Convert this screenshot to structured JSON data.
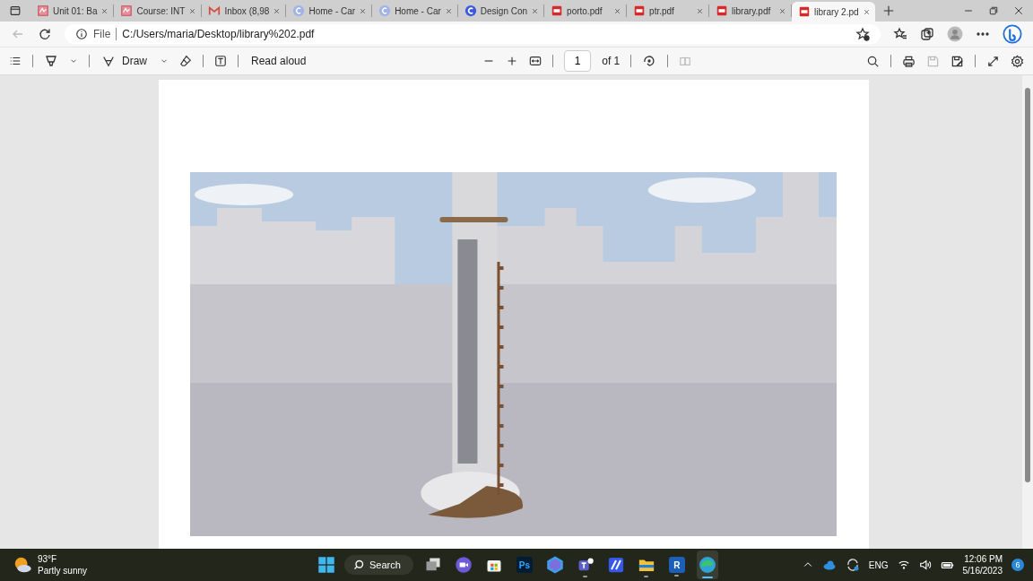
{
  "tabs": [
    {
      "kind": "pdf-pink",
      "label": "Unit 01: Ba",
      "selected": false
    },
    {
      "kind": "pdf-pink",
      "label": "Course: INT",
      "selected": false
    },
    {
      "kind": "mail",
      "label": "Inbox (8,98",
      "selected": false
    },
    {
      "kind": "circle-c",
      "label": "Home - Car",
      "selected": false
    },
    {
      "kind": "circle-c",
      "label": "Home - Car",
      "selected": false
    },
    {
      "kind": "circle-c-bold",
      "label": "Design Con",
      "selected": false
    },
    {
      "kind": "pdf",
      "label": "porto.pdf",
      "selected": false
    },
    {
      "kind": "pdf",
      "label": "ptr.pdf",
      "selected": false
    },
    {
      "kind": "pdf",
      "label": "library.pdf",
      "selected": false
    },
    {
      "kind": "pdf",
      "label": "library 2.pd",
      "selected": true
    }
  ],
  "address_bar": {
    "scheme": "File",
    "url": "C:/Users/maria/Desktop/library%202.pdf"
  },
  "pdf_toolbar": {
    "draw_label": "Draw",
    "read_aloud_label": "Read aloud",
    "page_number": "1",
    "page_count": "of 1"
  },
  "taskbar": {
    "weather": {
      "temperature": "93°F",
      "condition": "Partly sunny"
    },
    "search_label": "Search",
    "apps": [
      {
        "kind": "taskview",
        "running": false
      },
      {
        "kind": "meet",
        "running": false
      },
      {
        "kind": "store",
        "running": false
      },
      {
        "kind": "ps",
        "label": "Ps",
        "running": false
      },
      {
        "kind": "copilot",
        "running": false
      },
      {
        "kind": "teams",
        "running": true
      },
      {
        "kind": "clip",
        "running": false
      },
      {
        "kind": "folder",
        "running": true
      },
      {
        "kind": "revit",
        "label": "R",
        "running": true
      },
      {
        "kind": "edge",
        "running": true,
        "selected": true
      }
    ],
    "language": "ENG",
    "time": "12:06 PM",
    "date": "5/16/2023",
    "notification_count": "6"
  }
}
